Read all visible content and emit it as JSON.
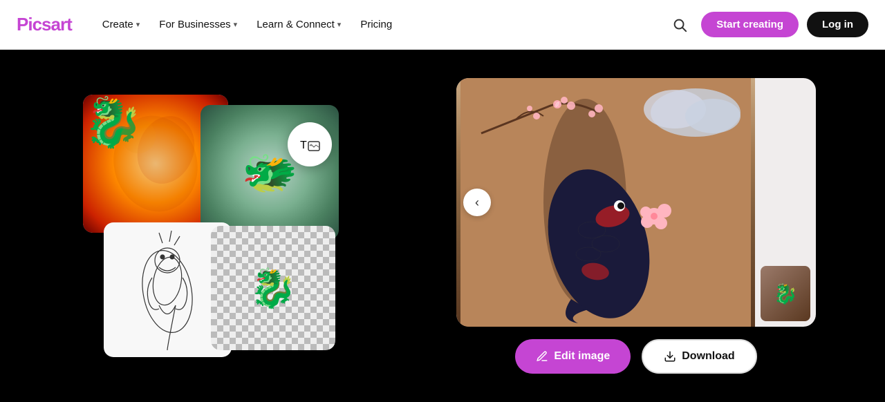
{
  "nav": {
    "logo": "Picsart",
    "items": [
      {
        "id": "create",
        "label": "Create",
        "hasDropdown": true
      },
      {
        "id": "for-businesses",
        "label": "For Businesses",
        "hasDropdown": true
      },
      {
        "id": "learn-connect",
        "label": "Learn & Connect",
        "hasDropdown": true
      },
      {
        "id": "pricing",
        "label": "Pricing",
        "hasDropdown": false
      }
    ],
    "search_aria": "Search",
    "cta_label": "Start creating",
    "login_label": "Log in"
  },
  "main": {
    "tool_icon": "✏",
    "prev_btn_label": "‹",
    "edit_btn_label": "Edit image",
    "download_btn_label": "Download",
    "edit_icon": "✏",
    "download_icon": "⬇"
  },
  "colors": {
    "brand_purple": "#c545d3",
    "nav_bg": "#ffffff",
    "main_bg": "#000000",
    "btn_dark": "#111111"
  }
}
